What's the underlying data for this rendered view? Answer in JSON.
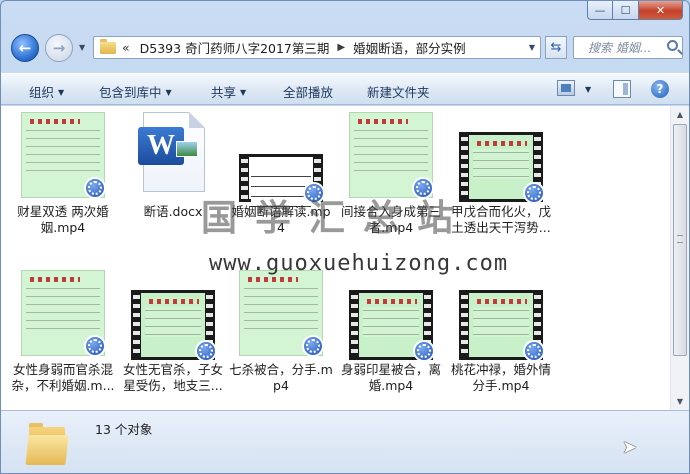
{
  "window": {
    "minimize": "—",
    "maximize": "☐",
    "close": "✕"
  },
  "nav": {
    "back_icon": "back-arrow-icon",
    "forward_icon": "forward-arrow-icon",
    "breadcrumb_lead": "«",
    "path": [
      "D5393 奇门药师八字2017第三期",
      "婚姻断语，部分实例"
    ],
    "separator": "▶",
    "search_placeholder": "搜索 婚姻..."
  },
  "toolbar": {
    "organize": "组织",
    "include_library": "包含到库中",
    "share": "共享",
    "play_all": "全部播放",
    "new_folder": "新建文件夹"
  },
  "files": [
    {
      "name": "财星双透 两次婚姻.mp4",
      "thumb": "green"
    },
    {
      "name": "断语.docx",
      "thumb": "docx"
    },
    {
      "name": "婚姻断语解读.mp4",
      "thumb": "filmwhite"
    },
    {
      "name": "间接合入身成第三者.mp4",
      "thumb": "green"
    },
    {
      "name": "甲戊合而化火，戊土透出天干泻势...",
      "thumb": "film"
    },
    {
      "name": "女性身弱而官杀混杂，不利婚姻.m...",
      "thumb": "green"
    },
    {
      "name": "女性无官杀，子女星受伤，地支三...",
      "thumb": "film"
    },
    {
      "name": "七杀被合，分手.mp4",
      "thumb": "film"
    },
    {
      "name": "身弱印星被合，离婚.mp4",
      "thumb": "film"
    },
    {
      "name": "桃花冲禄，婚外情分手.mp4",
      "thumb": "film"
    }
  ],
  "watermark": {
    "title": "国学汇总站",
    "url": "www.guoxuehuizong.com"
  },
  "status": {
    "count": "13 个对象"
  },
  "colors": {
    "accent": "#1e395b",
    "thumb_green": "#d3f5d3",
    "media_badge": "#1b4fb5"
  }
}
